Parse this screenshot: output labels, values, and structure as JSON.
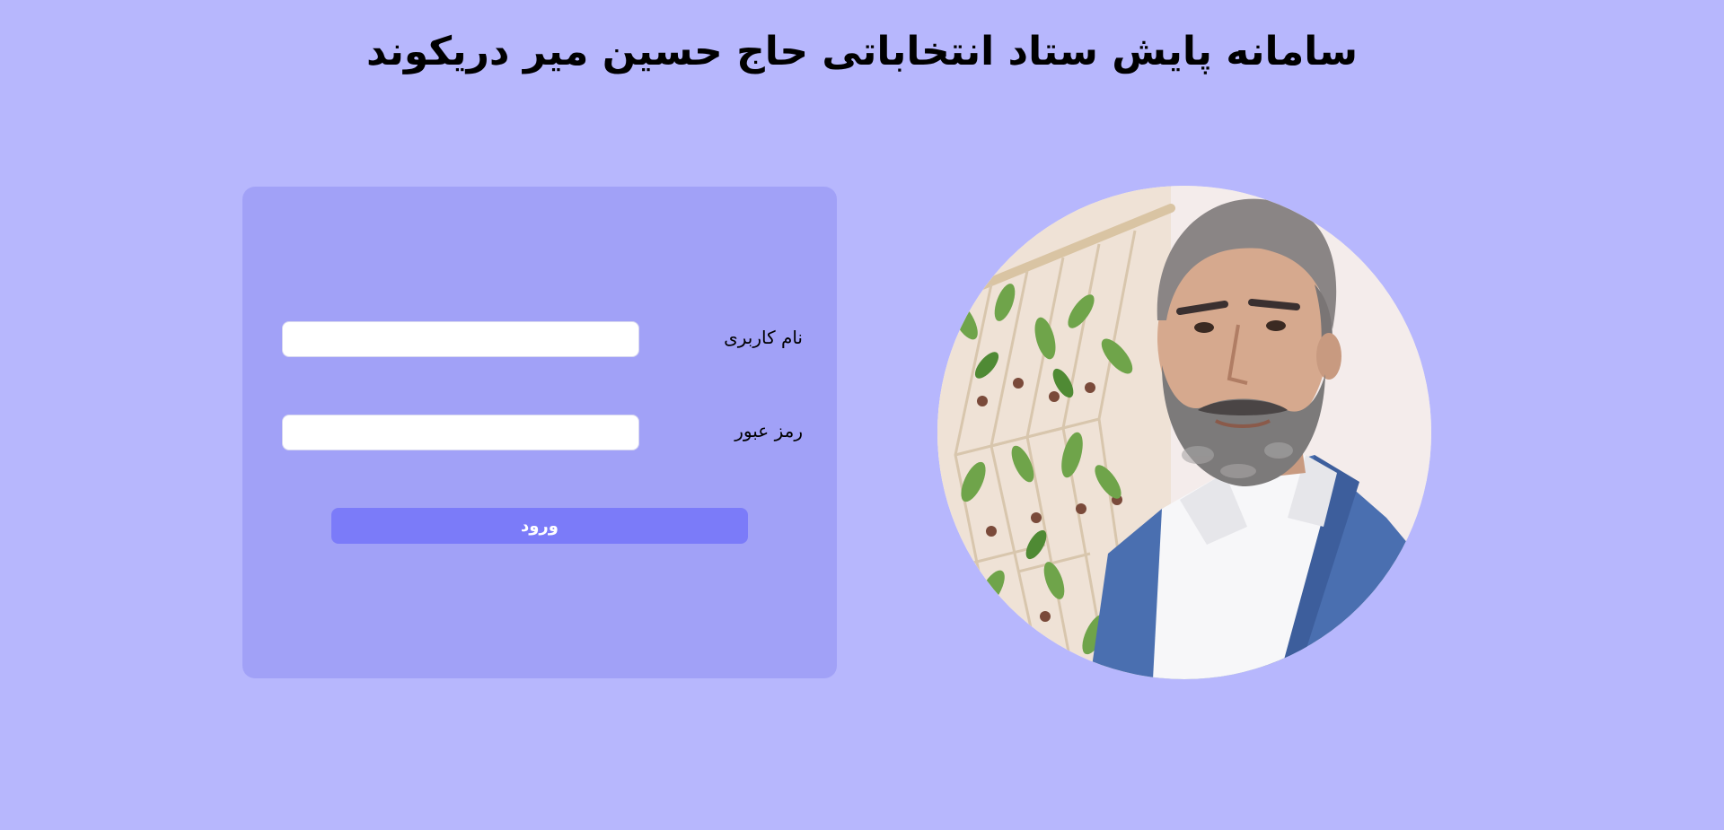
{
  "page": {
    "title": "سامانه پایش ستاد انتخاباتی حاج حسین میر دریکوند"
  },
  "login": {
    "username_label": "نام کاربری",
    "username_value": "",
    "password_label": "رمز عبور",
    "password_value": "",
    "submit_label": "ورود"
  },
  "colors": {
    "background": "#b7b7fd",
    "card": "#a1a1f7",
    "button": "#7b7bf9",
    "input": "#ffffff"
  },
  "portrait": {
    "subject": "candidate-photo"
  }
}
